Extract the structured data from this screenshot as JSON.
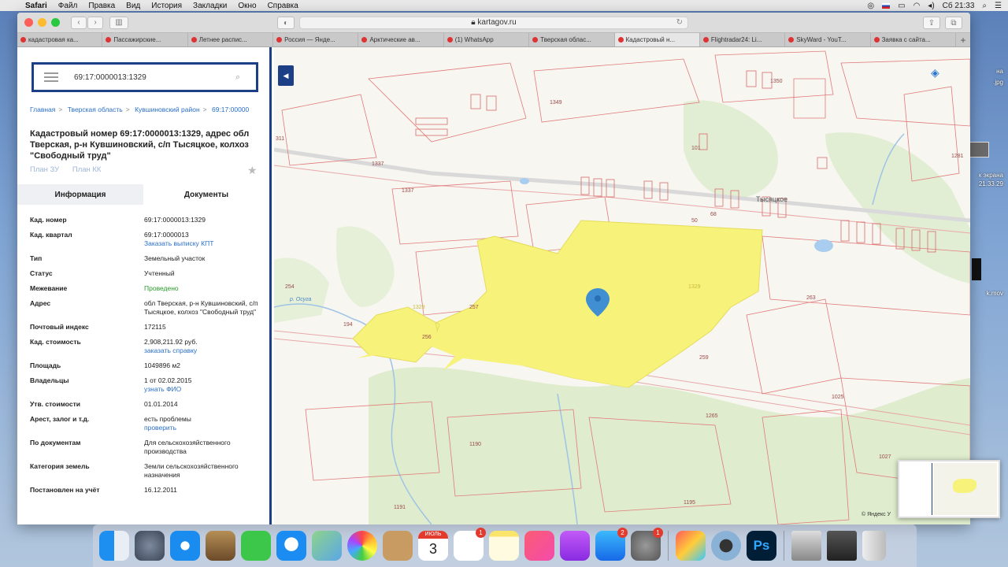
{
  "menubar": {
    "app": "Safari",
    "items": [
      "Файл",
      "Правка",
      "Вид",
      "История",
      "Закладки",
      "Окно",
      "Справка"
    ],
    "clock": "Сб 21:33"
  },
  "desktop": {
    "labels": [
      "на",
      ".jpg",
      "к экрана",
      "21.33.29",
      "k.mov"
    ]
  },
  "browser": {
    "url": "kartagov.ru",
    "tabs": [
      "кадастровая ка...",
      "Пассажирские...",
      "Летнее распис...",
      "Россия — Янде...",
      "Арктические ав...",
      "(1) WhatsApp",
      "Тверская облас...",
      "Кадастровый н...",
      "Flightradar24: Li...",
      "SkyWard - YouT...",
      "Заявка с сайта..."
    ],
    "active_tab": 7
  },
  "panel": {
    "search_value": "69:17:0000013:1329",
    "breadcrumb": [
      "Главная",
      "Тверская область",
      "Кувшиновский район",
      "69:17:00000"
    ],
    "title": "Кадастровый номер 69:17:0000013:1329, адрес обл Тверская, р-н Кувшиновский, с/п Тысяцкое, колхоз \"Свободный труд\"",
    "plan_zu": "План ЗУ",
    "plan_kk": "План КК",
    "tab_info": "Информация",
    "tab_docs": "Документы",
    "props": [
      {
        "k": "Кад. номер",
        "v": "69:17:0000013:1329"
      },
      {
        "k": "Кад. квартал",
        "v": "69:17:0000013",
        "link": "Заказать выписку КПТ"
      },
      {
        "k": "Тип",
        "v": "Земельный участок"
      },
      {
        "k": "Статус",
        "v": "Учтенный"
      },
      {
        "k": "Межевание",
        "v": "Проведено",
        "green": true
      },
      {
        "k": "Адрес",
        "v": "обл Тверская, р-н Кувшиновский, с/п Тысяцкое, колхоз \"Свободный труд\""
      },
      {
        "k": "Почтовый индекс",
        "v": "172115"
      },
      {
        "k": "Кад. стоимость",
        "v": "2,908,211.92 руб.",
        "link": "заказать справку"
      },
      {
        "k": "Площадь",
        "v": "1049896 м2"
      },
      {
        "k": "Владельцы",
        "v": "1 от 02.02.2015",
        "link": "узнать ФИО"
      },
      {
        "k": "Утв. стоимости",
        "v": "01.01.2014"
      },
      {
        "k": "Арест, залог и т.д.",
        "v": "есть проблемы",
        "link": "проверить"
      },
      {
        "k": "По документам",
        "v": "Для сельскохозяйственного производства"
      },
      {
        "k": "Категория земель",
        "v": "Земли сельскохозяйственного назначения"
      },
      {
        "k": "Постановлен на учёт",
        "v": "16.12.2011"
      }
    ]
  },
  "map": {
    "village": "Тысяцкое",
    "river": "р. Осуга",
    "copyright": "© Яндекс У",
    "parcels": [
      "1349",
      "1350",
      "1281",
      "1337",
      "1337",
      "311",
      "254",
      "194",
      "257",
      "256",
      "1329",
      "1329",
      "259",
      "263",
      "1025",
      "1265",
      "1190",
      "1191",
      "1195",
      "1027",
      "50",
      "68",
      "101"
    ]
  },
  "dock": {
    "calendar_month": "ИЮЛЬ",
    "calendar_day": "3",
    "reminders_badge": "1",
    "appstore_badge": "2",
    "prefs_badge": "1",
    "ps_label": "Ps"
  }
}
